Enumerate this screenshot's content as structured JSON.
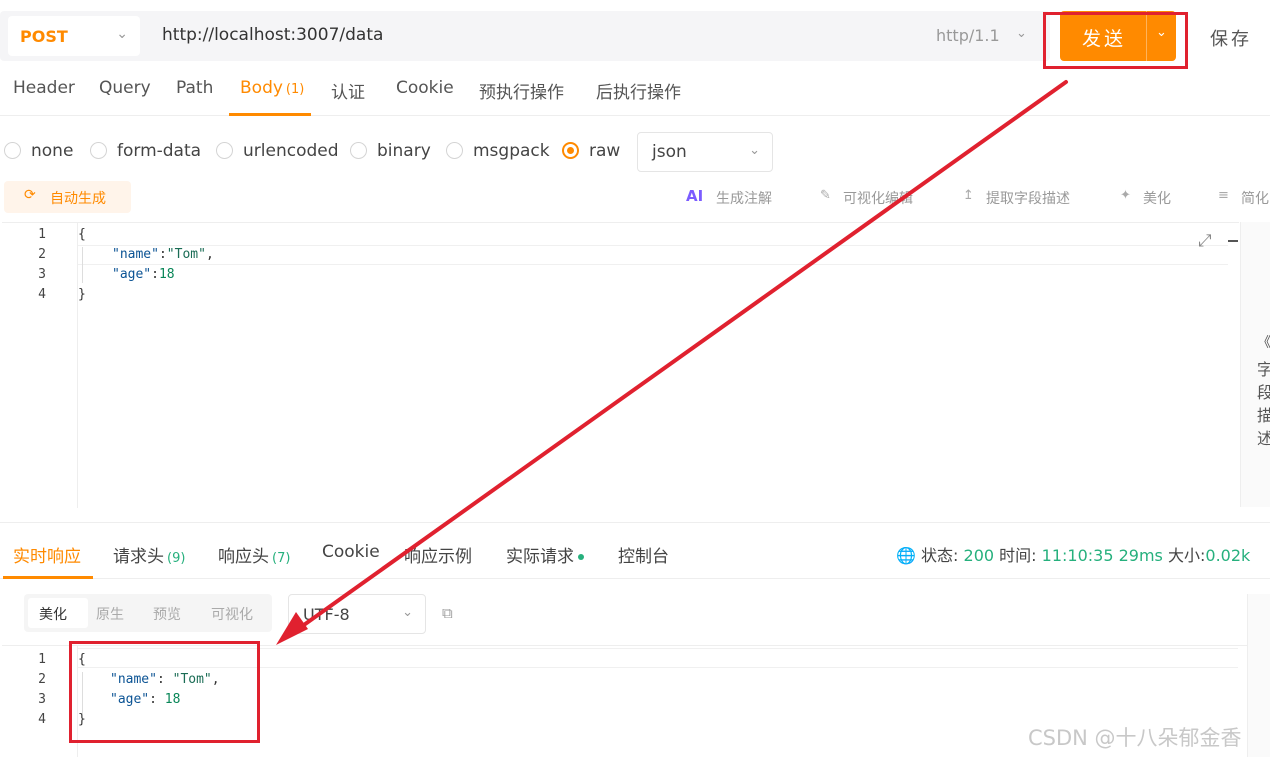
{
  "request": {
    "method": "POST",
    "url": "http://localhost:3007/data",
    "http_version": "http/1.1",
    "send_label": "发送",
    "save_label": "保存"
  },
  "tabs": [
    {
      "label": "Header"
    },
    {
      "label": "Query"
    },
    {
      "label": "Path"
    },
    {
      "label": "Body",
      "count": "(1)"
    },
    {
      "label": "认证"
    },
    {
      "label": "Cookie"
    },
    {
      "label": "预执行操作"
    },
    {
      "label": "后执行操作"
    }
  ],
  "body_types": [
    "none",
    "form-data",
    "urlencoded",
    "binary",
    "msgpack",
    "raw"
  ],
  "body_type_selected": "raw",
  "format": "json",
  "toolbar": {
    "auto_generate": "自动生成",
    "ai_badge": "AI",
    "gen_comments": "生成注解",
    "visual_edit": "可视化编辑",
    "extract_fields": "提取字段描述",
    "beautify": "美化",
    "simplify": "简化"
  },
  "request_editor": {
    "line_numbers": [
      "1",
      "2",
      "3",
      "4"
    ],
    "open_brace": "{",
    "close_brace": "}",
    "name_key": "\"name\"",
    "name_value": "\"Tom\"",
    "age_key": "\"age\"",
    "age_value": "18"
  },
  "field_sidebar": {
    "collapse_icon": "《",
    "text": "字段描述"
  },
  "response": {
    "tabs": [
      {
        "label": "实时响应"
      },
      {
        "label": "请求头",
        "count": "(9)"
      },
      {
        "label": "响应头",
        "count": "(7)"
      },
      {
        "label": "Cookie"
      },
      {
        "label": "响应示例"
      },
      {
        "label": "实际请求"
      },
      {
        "label": "控制台"
      }
    ],
    "status_label": "状态:",
    "status_value": "200",
    "time_label": "时间:",
    "time_value": "11:10:35",
    "duration": "29ms",
    "size_label": "大小:",
    "size_value": "0.02k",
    "views": [
      "美化",
      "原生",
      "预览",
      "可视化"
    ],
    "encoding": "UTF-8",
    "editor": {
      "line_numbers": [
        "1",
        "2",
        "3",
        "4"
      ],
      "open_brace": "{",
      "close_brace": "}",
      "name_key": "\"name\"",
      "name_value": "\"Tom\"",
      "age_key": "\"age\"",
      "age_value": "18"
    }
  },
  "annotation_color": "#e0212f",
  "accent_color": "#ff8a00",
  "watermark": "CSDN @十八朵郁金香"
}
